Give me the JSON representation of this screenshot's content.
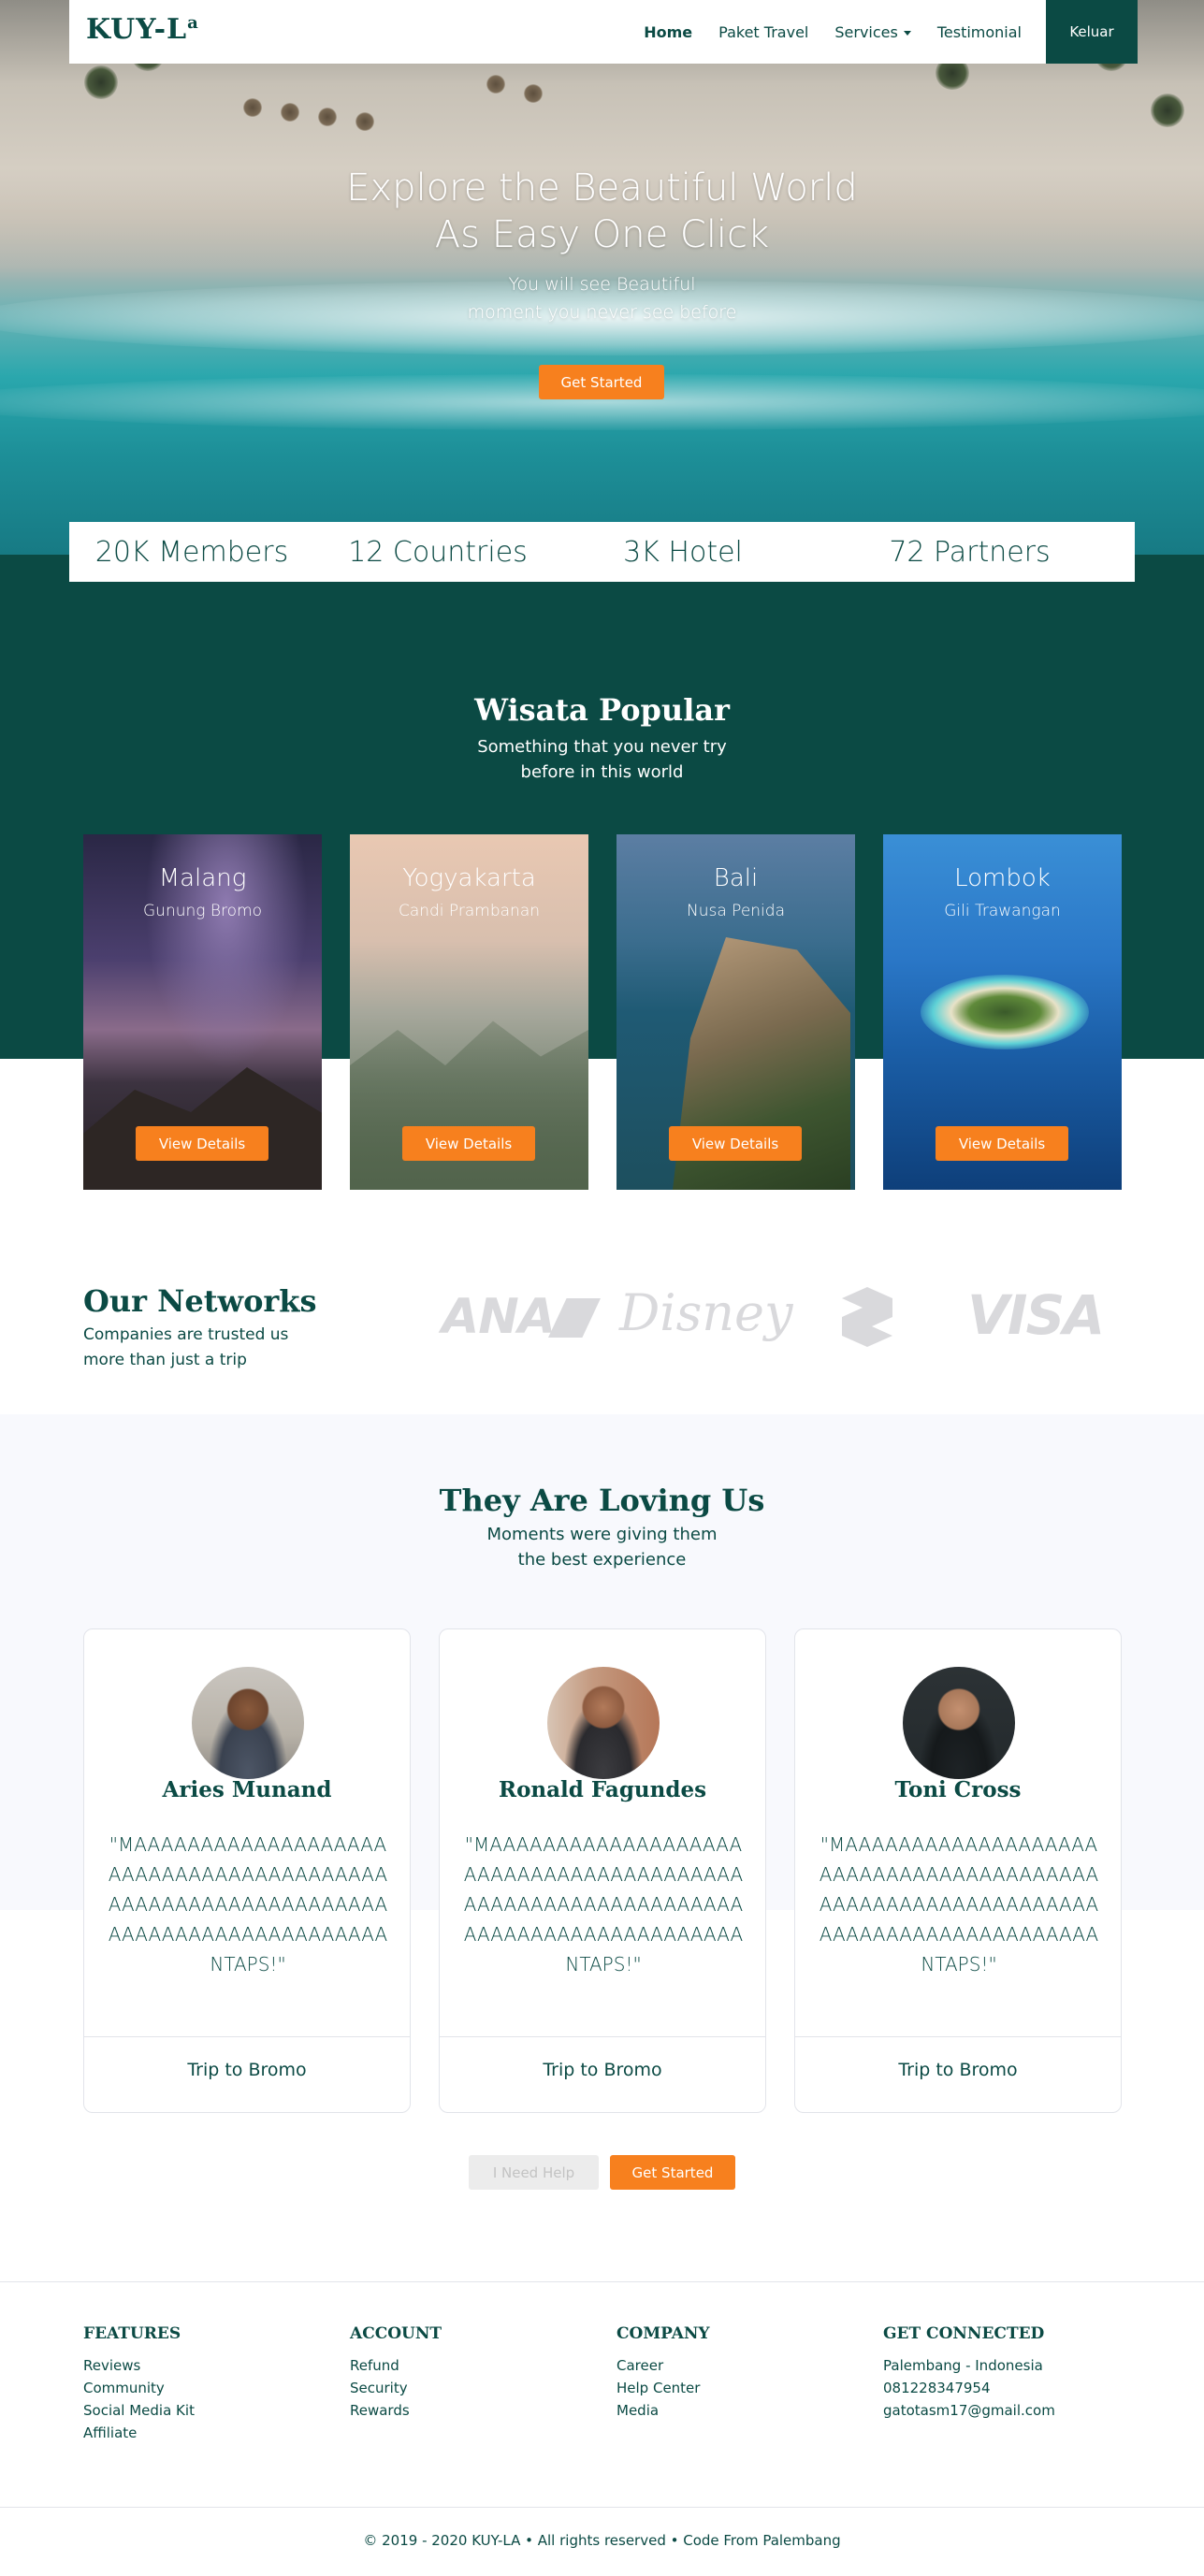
{
  "brand": {
    "name": "KUY-La"
  },
  "nav": {
    "links": [
      "Home",
      "Paket Travel",
      "Services",
      "Testimonial"
    ],
    "logout": "Keluar"
  },
  "hero": {
    "title_line1": "Explore the Beautiful World",
    "title_line2": "As Easy One Click",
    "sub_line1": "You will see Beautiful",
    "sub_line2": "moment you never see before",
    "cta": "Get Started"
  },
  "stats": [
    "20K Members",
    "12 Countries",
    "3K Hotel",
    "72 Partners"
  ],
  "wisata": {
    "title": "Wisata Popular",
    "sub_line1": "Something that you never try",
    "sub_line2": "before in this world",
    "cards": [
      {
        "city": "Malang",
        "place": "Gunung Bromo",
        "button": "View Details"
      },
      {
        "city": "Yogyakarta",
        "place": "Candi Prambanan",
        "button": "View Details"
      },
      {
        "city": "Bali",
        "place": "Nusa Penida",
        "button": "View Details"
      },
      {
        "city": "Lombok",
        "place": "Gili Trawangan",
        "button": "View Details"
      }
    ]
  },
  "networks": {
    "title": "Our Networks",
    "sub_line1": "Companies are trusted us",
    "sub_line2": "more than just a trip",
    "logos": [
      "ANA",
      "Disney",
      "VISA"
    ]
  },
  "testimonials": {
    "title": "They Are Loving Us",
    "sub_line1": "Moments were giving them",
    "sub_line2": "the best experience",
    "items": [
      {
        "name": "Aries Munand",
        "quote": "\"MAAAAAAAAAAAAAAAAAAAAAAAAAAAAAAAAAAAAAAAAAAAAAAAAAAAAAAAAAAAAAAAAAAAAAAAAAAAAAAAAAANTAPS!\"",
        "trip": "Trip to Bromo"
      },
      {
        "name": "Ronald Fagundes",
        "quote": "\"MAAAAAAAAAAAAAAAAAAAAAAAAAAAAAAAAAAAAAAAAAAAAAAAAAAAAAAAAAAAAAAAAAAAAAAAAAAAAAAAAAANTAPS!\"",
        "trip": "Trip to Bromo"
      },
      {
        "name": "Toni Cross",
        "quote": "\"MAAAAAAAAAAAAAAAAAAAAAAAAAAAAAAAAAAAAAAAAAAAAAAAAAAAAAAAAAAAAAAAAAAAAAAAAAAAAAAAAAANTAPS!\"",
        "trip": "Trip to Bromo"
      }
    ],
    "help_button": "I Need Help",
    "start_button": "Get Started"
  },
  "footer": {
    "columns": [
      {
        "title": "FEATURES",
        "items": [
          "Reviews",
          "Community",
          "Social Media Kit",
          "Affiliate"
        ]
      },
      {
        "title": "ACCOUNT",
        "items": [
          "Refund",
          "Security",
          "Rewards"
        ]
      },
      {
        "title": "COMPANY",
        "items": [
          "Career",
          "Help Center",
          "Media"
        ]
      },
      {
        "title": "GET CONNECTED",
        "items": [
          "Palembang - Indonesia",
          "081228347954",
          "gatotasm17@gmail.com"
        ]
      }
    ],
    "copyright": "© 2019 - 2020 KUY-LA • All rights reserved • Code From Palembang"
  },
  "colors": {
    "primary": "#0b4a44",
    "accent": "#f7801e",
    "muted_bg": "#f8f9fd"
  },
  "icons": [
    "caret-down-icon",
    "avatar-image",
    "shield-logo-icon"
  ]
}
